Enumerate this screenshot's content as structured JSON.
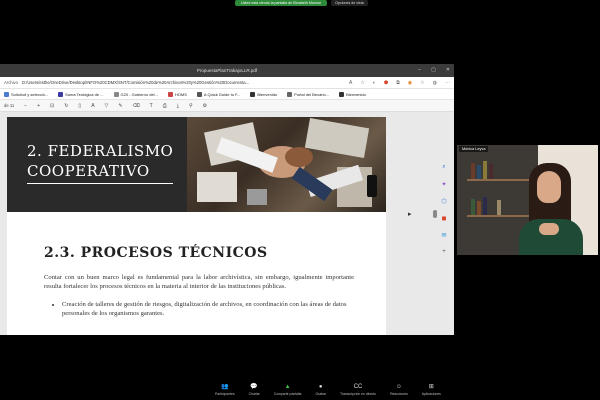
{
  "share_banner": {
    "status": "Usted está viendo la pantalla de Elizabeth Monroe",
    "options_label": "Opciones de vista"
  },
  "browser": {
    "tab_title": "PropuestaPlanTrabajoLLR.pdf",
    "address_prefix": "Archivo",
    "url": "D:/Users/esthe/OneDrive/Desktop/INFO%20CDMX/SNT/Comisión%20de%20Archivos%20y%20Gestión%20Documenta...",
    "bookmarks": [
      {
        "label": "Solicitud y selecció...",
        "color": "#4a7bd0"
      },
      {
        "label": "Suma Teológica de ...",
        "color": "#3a3aa0"
      },
      {
        "label": "G20 - Gobierno del...",
        "color": "#888888"
      },
      {
        "label": "HOMS",
        "color": "#c44"
      },
      {
        "label": "A Quick Guide to F...",
        "color": "#555555"
      },
      {
        "label": "Bienvenido",
        "color": "#333333"
      },
      {
        "label": "Portal del Becario...",
        "color": "#666666"
      },
      {
        "label": "Bienvenido",
        "color": "#333333"
      }
    ],
    "page_indicator": "de 11"
  },
  "document": {
    "header_title": "2. FEDERALISMO\nCOOPERATIVO",
    "heading": "2.3. PROCESOS TÉCNICOS",
    "paragraph": "Contar con un buen marco legal es fundamental para la labor archivística, sin embargo, igualmente importante resulta fortalecer los procesos técnicos en la materia al interior de las instituciones públicas.",
    "bullets": [
      "Creación de talleres de gestión de riesgos, digitalización de archivos, en coordinación con las áreas de datos personales de los organismos garantes."
    ]
  },
  "participant": {
    "name_tag": "Mónica Leyva"
  },
  "meeting_controls": [
    {
      "label": "Participantes",
      "icon": "participants-icon",
      "glyph": "👥",
      "tone": ""
    },
    {
      "label": "Charlar",
      "icon": "chat-icon",
      "glyph": "💬",
      "tone": "red"
    },
    {
      "label": "Compartir pantalla",
      "icon": "share-screen-icon",
      "glyph": "▲",
      "tone": "green"
    },
    {
      "label": "Grabar",
      "icon": "record-icon",
      "glyph": "●",
      "tone": ""
    },
    {
      "label": "Transcripción en directo",
      "icon": "captions-icon",
      "glyph": "CC",
      "tone": ""
    },
    {
      "label": "Reacciones",
      "icon": "reactions-icon",
      "glyph": "☺",
      "tone": ""
    },
    {
      "label": "Aplicaciones",
      "icon": "apps-icon",
      "glyph": "⊞",
      "tone": ""
    }
  ],
  "colors": {
    "share_green": "#2e8b3a",
    "header_dark": "#2a2a2a",
    "video_bg": "#3d3a35"
  }
}
